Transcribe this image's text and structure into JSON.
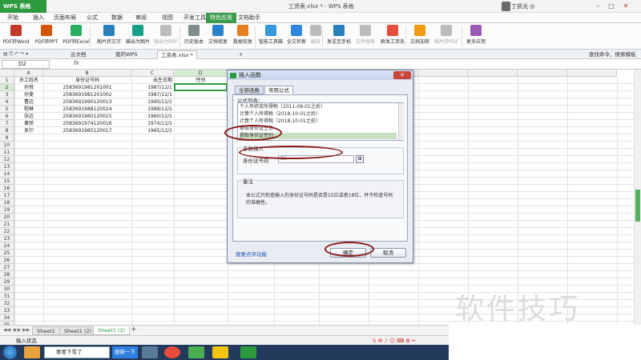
{
  "app": {
    "badge": "WPS 表格",
    "doc_title": "工资表.xlsx * - WPS 表格",
    "user": "丁凯光 ◎"
  },
  "menu": [
    "开始",
    "插入",
    "页面布局",
    "公式",
    "数据",
    "审阅",
    "视图",
    "开发工具",
    "特色应用",
    "文档助手"
  ],
  "ribbon": [
    {
      "label": "PDF转Word",
      "color": "#c0392b"
    },
    {
      "label": "PDF转PPT",
      "color": "#d35400"
    },
    {
      "label": "PDF转Excel",
      "color": "#27ae60"
    },
    {
      "label": "图片转文字",
      "color": "#2980b9"
    },
    {
      "label": "输出为图片",
      "color": "#16a085"
    },
    {
      "label": "输出为PDF",
      "color": "#bbbbbb"
    },
    {
      "label": "历史版本",
      "color": "#7f8c8d"
    },
    {
      "label": "文档修复",
      "color": "#2c82c9"
    },
    {
      "label": "数据恢复",
      "color": "#e67e22"
    },
    {
      "label": "智能工具箱",
      "color": "#3498db"
    },
    {
      "label": "全文检索",
      "color": "#2e86de"
    },
    {
      "label": "翻译",
      "color": "#bbbbbb"
    },
    {
      "label": "发送至手机",
      "color": "#2980b9"
    },
    {
      "label": "文件搜索",
      "color": "#bbbbbb"
    },
    {
      "label": "群发工资条",
      "color": "#e74c3c"
    },
    {
      "label": "文档加密",
      "color": "#f39c12"
    },
    {
      "label": "图片转PDF",
      "color": "#bbbbbb"
    },
    {
      "label": "更多应用",
      "color": "#9b59b6"
    }
  ],
  "tabs": [
    "云文档",
    "我的WPS",
    "工资表.xlsx *"
  ],
  "search_cmd": "查找命令、搜索模板",
  "formula_bar": {
    "name_box": "D2",
    "fx": "fx"
  },
  "columns": [
    "A",
    "B",
    "C",
    "D"
  ],
  "rows": [
    [
      "员工姓名",
      "身份证号码",
      "出生日期",
      "性别"
    ],
    [
      "孙悦",
      "2583691981201001",
      "1987/12/1",
      ""
    ],
    [
      "孙斐",
      "2583691981201002",
      "1987/12/1",
      ""
    ],
    [
      "曹迈",
      "2583691990120013",
      "1990/12/1",
      ""
    ],
    [
      "程琳",
      "2583691988120024",
      "1988/12/1",
      ""
    ],
    [
      "张迈",
      "2583691960120015",
      "1960/12/1",
      ""
    ],
    [
      "黄骄",
      "2583691974120016",
      "1974/12/1",
      ""
    ],
    [
      "吴尔",
      "2583691965120017",
      "1965/12/1",
      ""
    ]
  ],
  "dialog": {
    "title": "插入函数",
    "tabs": [
      "全部函数",
      "常用公式"
    ],
    "list_label": "公式列表：",
    "formulas": [
      "个人年终奖所得税（2011-09-01之后）",
      "计算个人所得税（2018-10-01之后）",
      "计算个人所得税（2018-10-01之前）",
      "提取身份证生日",
      "提取身份证性别"
    ],
    "param_label": "参数输入",
    "param_name": "身份证号码",
    "param_value": "B2",
    "note_label": "备注",
    "note": "本公式只检查输入的身份证号码是否是15位或者18位，并不检查号码的准确性。",
    "feedback": "我要点评功能",
    "ok": "确定",
    "cancel": "取消"
  },
  "sheets": [
    "Sheet1",
    "Sheet1 (2)",
    "Sheet1 (3)"
  ],
  "status": "输入状态",
  "taskbar": {
    "search_btn": "搜索一下",
    "window": "要要下雪了"
  },
  "watermark": "软件技巧"
}
